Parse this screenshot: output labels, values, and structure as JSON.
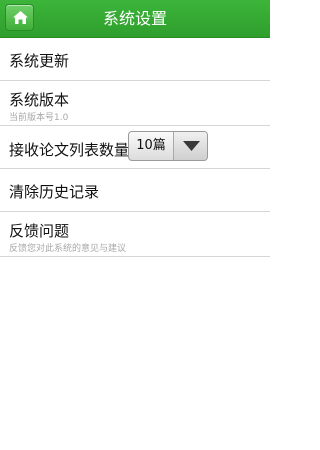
{
  "header": {
    "title": "系统设置",
    "home_icon": "home-icon",
    "color": "#35a833"
  },
  "settings": {
    "items": [
      {
        "label": "系统更新"
      },
      {
        "label": "系统版本",
        "sub": "当前版本号1.0"
      },
      {
        "label": "接收论文列表数量",
        "select_value": "10篇",
        "select_icon": "triangle-down-icon"
      },
      {
        "label": "清除历史记录"
      },
      {
        "label": "反馈问题",
        "sub": "反馈您对此系统的意见与建议"
      }
    ]
  }
}
